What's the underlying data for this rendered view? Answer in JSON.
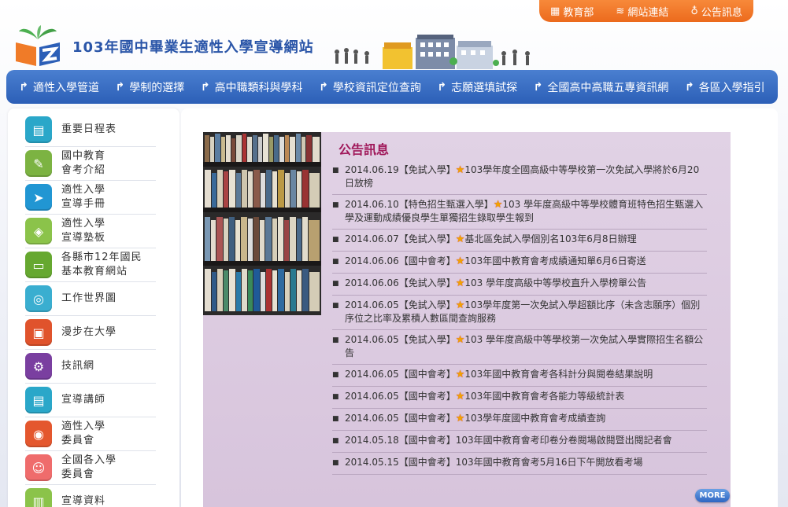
{
  "utility_bar": {
    "items": [
      {
        "icon": "building-icon",
        "label": "教育部"
      },
      {
        "icon": "wifi-icon",
        "label": "網站連結"
      },
      {
        "icon": "microphone-icon",
        "label": "公告訊息"
      }
    ]
  },
  "header": {
    "title": "103年國中畢業生適性入學宣導網站"
  },
  "nav": {
    "items": [
      {
        "label": "適性入學管道"
      },
      {
        "label": "學制的選擇"
      },
      {
        "label": "高中職類科與學科"
      },
      {
        "label": "學校資訊定位查詢"
      },
      {
        "label": "志願選填試探"
      },
      {
        "label": "全國高中高職五專資訊網"
      },
      {
        "label": "各區入學指引"
      }
    ]
  },
  "sidebar": {
    "items": [
      {
        "label": "重要日程表",
        "icon": "calendar-icon",
        "color": "#2aa7c9"
      },
      {
        "label": "國中教育\n會考介紹",
        "icon": "pencil-board-icon",
        "color": "#7cb342"
      },
      {
        "label": "適性入學\n宣導手冊",
        "icon": "paper-plane-icon",
        "color": "#2196d3"
      },
      {
        "label": "適性入學\n宣導塾板",
        "icon": "tag-icon",
        "color": "#8bc34a"
      },
      {
        "label": "各縣市12年國民\n基本教育網站",
        "icon": "monitor-icon",
        "color": "#66a830"
      },
      {
        "label": "工作世界圖",
        "icon": "map-icon",
        "color": "#3aaed0"
      },
      {
        "label": "漫步在大學",
        "icon": "briefcase-icon",
        "color": "#e0532c"
      },
      {
        "label": "技訊網",
        "icon": "gear-icon",
        "color": "#7a3fa0"
      },
      {
        "label": "宣導講師",
        "icon": "id-card-icon",
        "color": "#2aa7c9"
      },
      {
        "label": "適性入學\n委員會",
        "icon": "target-icon",
        "color": "#e4572e"
      },
      {
        "label": "全國各入學\n委員會",
        "icon": "person-icon",
        "color": "#ef6c6c"
      },
      {
        "label": "宣導資料",
        "icon": "document-icon",
        "color": "#8bc34a"
      }
    ]
  },
  "notices": {
    "title": "公告訊息",
    "more_label": "MORE",
    "items": [
      {
        "date": "2014.06.19",
        "category": "【免試入學】",
        "starred": true,
        "text": "103學年度全國高級中等學校第一次免試入學將於6月20日放榜"
      },
      {
        "date": "2014.06.10",
        "category": "【特色招生甄選入學】",
        "starred": true,
        "text": "103 學年度高級中等學校體育班特色招生甄選入學及運動成績優良學生單獨招生錄取學生報到"
      },
      {
        "date": "2014.06.07",
        "category": "【免試入學】",
        "starred": true,
        "text": "基北區免試入學個別名103年6月8日辦理"
      },
      {
        "date": "2014.06.06",
        "category": "【國中會考】",
        "starred": true,
        "text": "103年國中教育會考成績通知單6月6日寄送"
      },
      {
        "date": "2014.06.06",
        "category": "【免試入學】",
        "starred": true,
        "text": "103 學年度高級中等學校直升入學榜單公告"
      },
      {
        "date": "2014.06.05",
        "category": "【免試入學】",
        "starred": true,
        "text": "103學年度第一次免試入學超額比序（未含志願序）個別序位之比率及累積人數區間查詢服務"
      },
      {
        "date": "2014.06.05",
        "category": "【免試入學】",
        "starred": true,
        "text": "103 學年度高級中等學校第一次免試入學實際招生名額公告"
      },
      {
        "date": "2014.06.05",
        "category": "【國中會考】",
        "starred": true,
        "text": "103年國中教育會考各科計分與閱卷結果說明"
      },
      {
        "date": "2014.06.05",
        "category": "【國中會考】",
        "starred": true,
        "text": "103年國中教育會考各能力等級統計表"
      },
      {
        "date": "2014.06.05",
        "category": "【國中會考】",
        "starred": true,
        "text": "103學年度國中教育會考成績查詢"
      },
      {
        "date": "2014.05.18",
        "category": "【國中會考】",
        "starred": false,
        "text": "103年國中教育會考印卷分卷閱場啟閱暨出閱記者會"
      },
      {
        "date": "2014.05.15",
        "category": "【國中會考】",
        "starred": false,
        "text": "103年國中教育會考5月16日下午開放看考場"
      }
    ]
  }
}
